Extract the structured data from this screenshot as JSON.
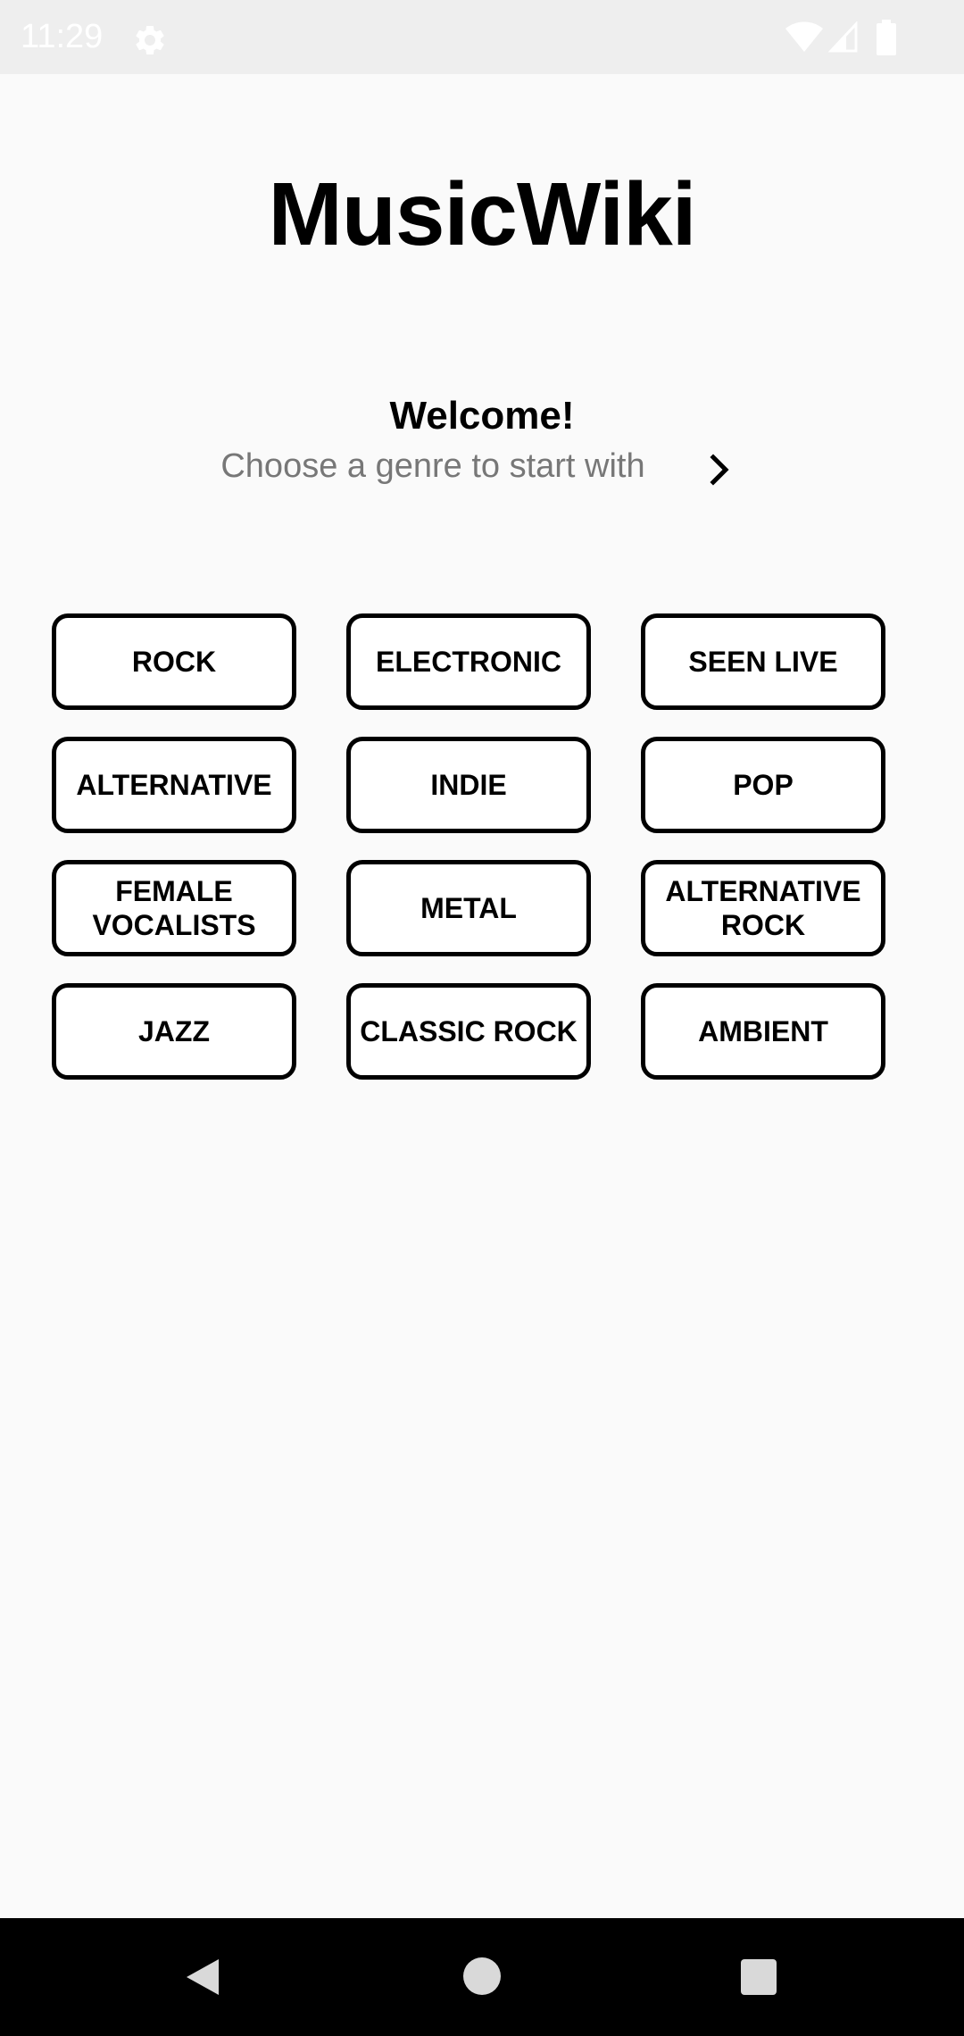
{
  "status_bar": {
    "time": "11:29",
    "icons": [
      "gear-icon",
      "wifi-icon",
      "signal-icon",
      "battery-icon"
    ]
  },
  "app": {
    "title": "MusicWiki"
  },
  "welcome": {
    "title": "Welcome!",
    "subtitle": "Choose a genre to start with",
    "next_icon": "chevron-right-icon"
  },
  "genres": [
    {
      "label": "ROCK"
    },
    {
      "label": "ELECTRONIC"
    },
    {
      "label": "SEEN LIVE"
    },
    {
      "label": "ALTERNATIVE"
    },
    {
      "label": "INDIE"
    },
    {
      "label": "POP"
    },
    {
      "label": "FEMALE VOCALISTS"
    },
    {
      "label": "METAL"
    },
    {
      "label": "ALTERNATIVE ROCK"
    },
    {
      "label": "JAZZ"
    },
    {
      "label": "CLASSIC ROCK"
    },
    {
      "label": "AMBIENT"
    }
  ],
  "nav_bar": {
    "icons": [
      "back-icon",
      "home-icon",
      "recents-icon"
    ]
  },
  "colors": {
    "background": "#fafafa",
    "status_bar": "#eeeeee",
    "nav_bar": "#000000",
    "chip_border": "#000000",
    "subtitle_text": "#777777"
  }
}
